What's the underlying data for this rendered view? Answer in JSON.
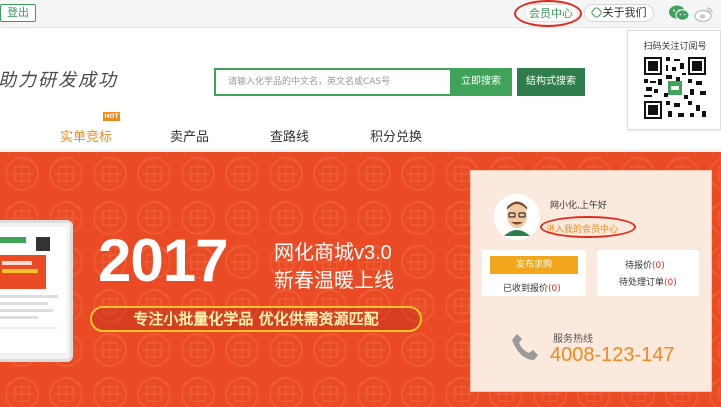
{
  "topbar": {
    "login_label": "登出",
    "member_label": "会员中心",
    "about_label": "关于我们",
    "icons": [
      "link-icon",
      "wechat-icon",
      "weibo-icon"
    ]
  },
  "qr_popup": {
    "caption": "扫码关注订阅号"
  },
  "header": {
    "slogan": "助力研发成功",
    "search_placeholder": "请输入化学品的中文名，英文名或CAS号",
    "search_label": "立即搜索",
    "structure_search_label": "结构式搜索"
  },
  "nav": {
    "items": [
      {
        "label": "实单竞标"
      },
      {
        "label": "卖产品"
      },
      {
        "label": "查路线"
      },
      {
        "label": "积分兑换"
      }
    ],
    "hot_badge": "HOT"
  },
  "banner": {
    "year": "2017",
    "title1": "网化商城v3.0",
    "title2": "新春温暖上线",
    "subtitle": "专注小批量化学品 优化供需资源匹配"
  },
  "member_card": {
    "greeting": "网小化,上午好",
    "enter_link": "进入我的会员中心",
    "post_request_label": "发布求购",
    "received_quotes_label": "已收到报价",
    "received_quotes_count": "(0)",
    "pending_quotes_label": "待报价",
    "pending_quotes_count": "(0)",
    "pending_orders_label": "待处理订单",
    "pending_orders_count": "(0)",
    "hotline_label": "服务热线",
    "hotline_number": "4008-123-147"
  },
  "colors": {
    "brand_green": "#3fa35a",
    "dark_green": "#2f7d4a",
    "banner_red": "#ea4b25",
    "accent_orange": "#f08a1c",
    "highlight_ring": "#e22a1b"
  }
}
